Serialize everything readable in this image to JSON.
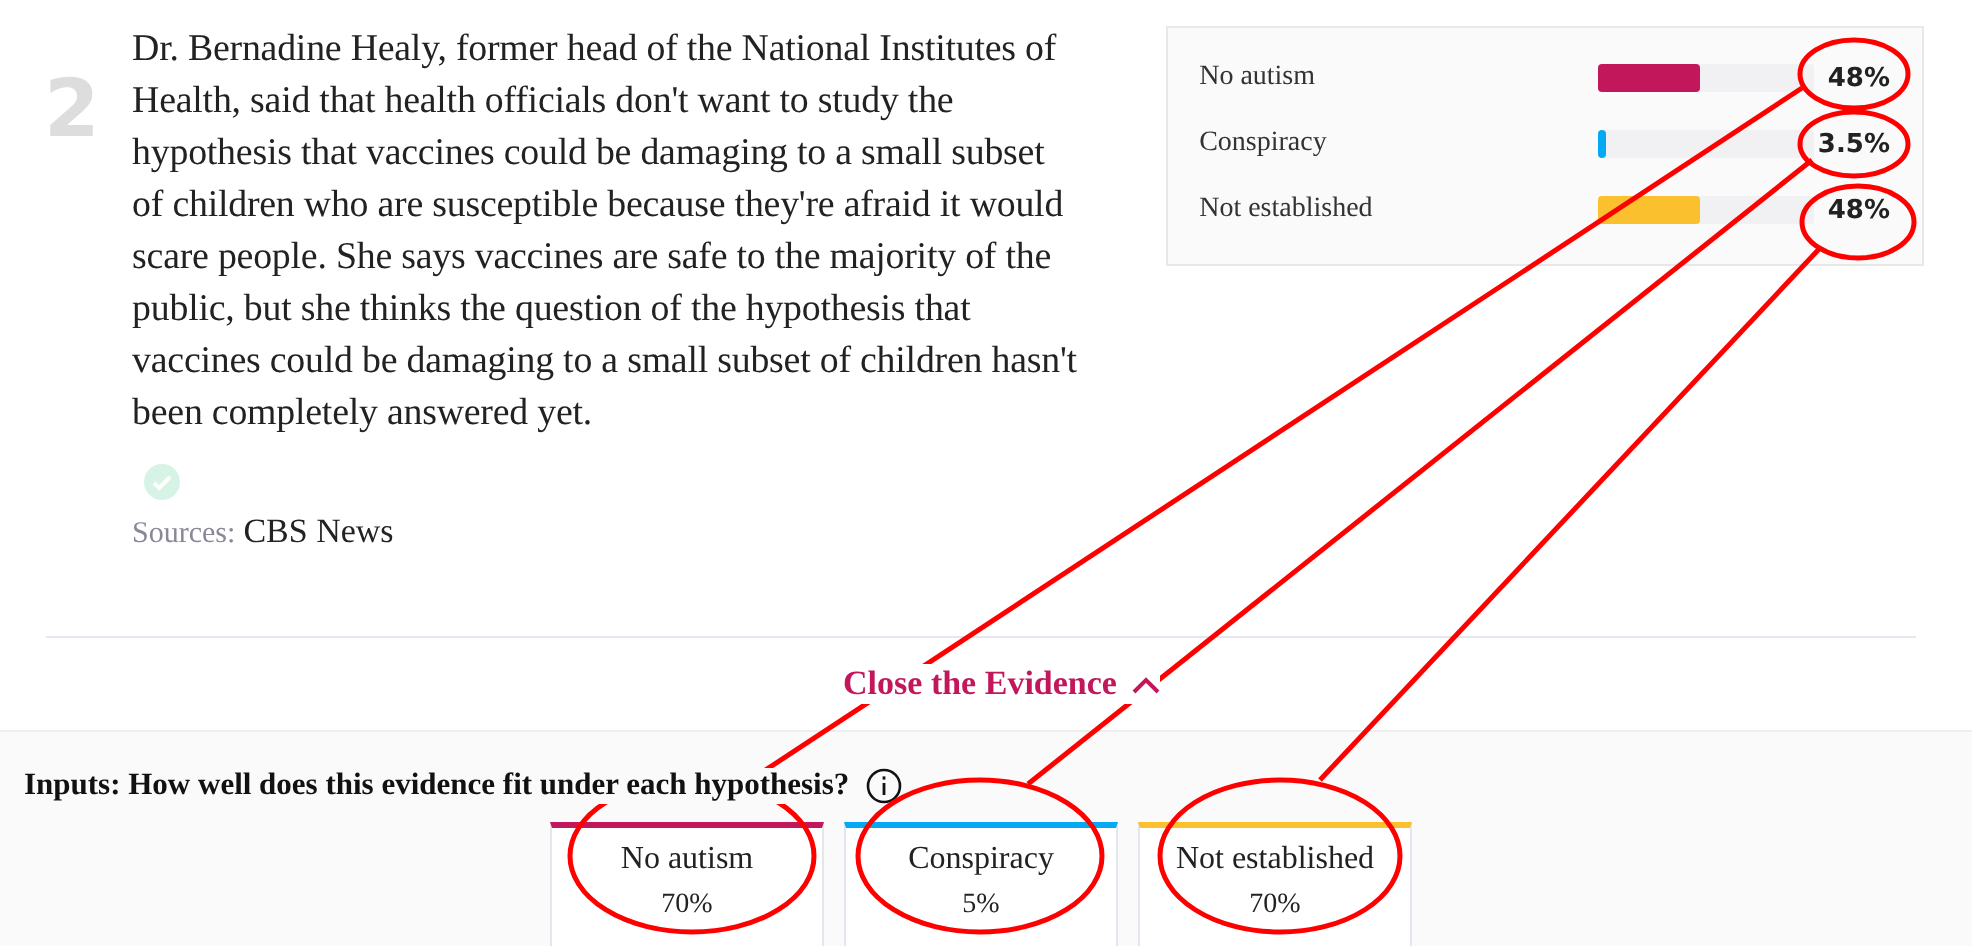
{
  "evidence": {
    "number": "2",
    "text": "Dr. Bernadine Healy, former head of the National Institutes of Health, said that health officials don't want to study the hypothesis that vaccines could be damaging to a small subset of children who are susceptible because they're afraid it would scare people. She says vaccines are safe to the majority of the public, but she thinks the question of the hypothesis that vaccines could be damaging to a small subset of children hasn't been completely answered yet.",
    "verified": true,
    "sources_label": "Sources:",
    "source": "CBS News"
  },
  "results": [
    {
      "name": "No autism",
      "color": "#c2185b",
      "level": 0.48,
      "reading": "48%"
    },
    {
      "name": "Conspiracy",
      "color": "#03a9f4",
      "level": 0.035,
      "reading": "3.5%"
    },
    {
      "name": "Not established",
      "color": "#fbc02d",
      "level": 0.48,
      "reading": "48%"
    }
  ],
  "toggle": {
    "label": "Close the Evidence",
    "expanded": true
  },
  "inputs": {
    "question": "Inputs: How well does this evidence fit under each hypothesis?",
    "cards": [
      {
        "name": "No autism",
        "color": "#c2185b",
        "value": "70%"
      },
      {
        "name": "Conspiracy",
        "color": "#03a9f4",
        "value": "5%"
      },
      {
        "name": "Not established",
        "color": "#fbc02d",
        "value": "70%"
      }
    ]
  }
}
